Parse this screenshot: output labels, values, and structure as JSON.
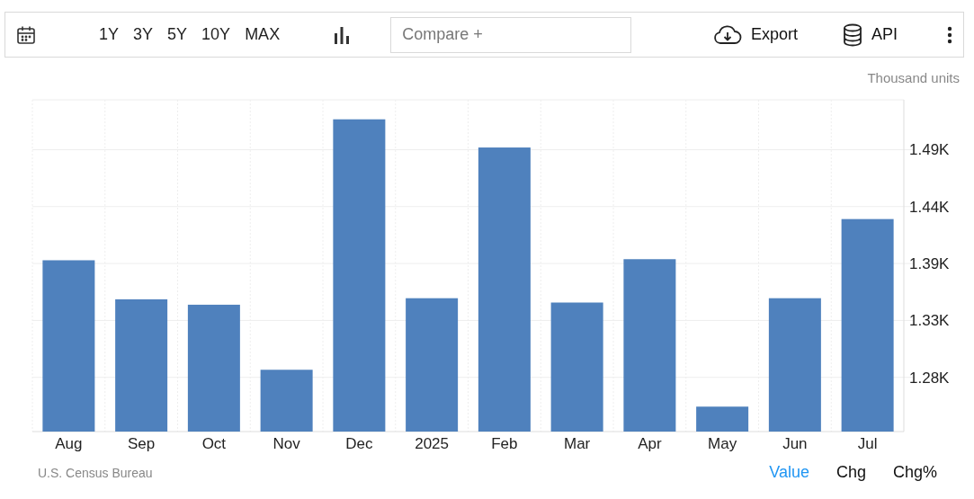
{
  "toolbar": {
    "ranges": [
      "1Y",
      "3Y",
      "5Y",
      "10Y",
      "MAX"
    ],
    "compare": {
      "placeholder": "Compare +"
    },
    "export": "Export",
    "api": "API"
  },
  "unit": "Thousand units",
  "chart_data": {
    "type": "bar",
    "categories": [
      "Aug",
      "Sep",
      "Oct",
      "Nov",
      "Dec",
      "2025",
      "Feb",
      "Mar",
      "Apr",
      "May",
      "Jun",
      "Jul"
    ],
    "grid": true,
    "series": [
      {
        "color": "#4f81bd",
        "values": [
          1.388,
          1.352,
          1.347,
          1.287,
          1.518,
          1.353,
          1.492,
          1.349,
          1.389,
          1.253,
          1.353,
          1.426
        ]
      }
    ],
    "ylim": [
      1.23,
      1.536
    ],
    "yticks": [
      {
        "value": 1.28,
        "label": "1.28K"
      },
      {
        "value": 1.3325,
        "label": "1.33K"
      },
      {
        "value": 1.385,
        "label": "1.39K"
      },
      {
        "value": 1.4375,
        "label": "1.44K"
      },
      {
        "value": 1.49,
        "label": "1.49K"
      }
    ]
  },
  "source": "U.S. Census Bureau",
  "views": [
    {
      "label": "Value",
      "selected": true
    },
    {
      "label": "Chg",
      "selected": false
    },
    {
      "label": "Chg%",
      "selected": false
    }
  ]
}
